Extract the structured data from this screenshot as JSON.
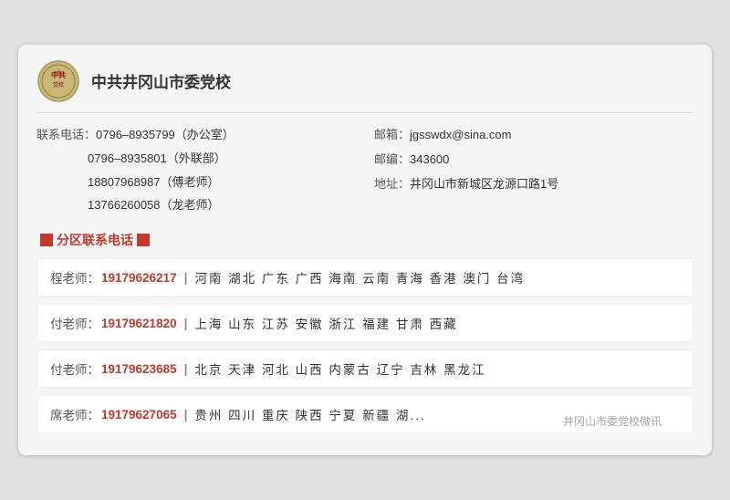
{
  "org": {
    "name": "中共井冈山市委党校",
    "logo_alt": "party-school-logo"
  },
  "contact": {
    "phones_label": "联系电话：",
    "phones": [
      {
        "number": "0796–8935799",
        "note": "（办公室）"
      },
      {
        "number": "0796–8935801",
        "note": "（外联部）"
      },
      {
        "number": "18807968987",
        "note": "（傅老师）"
      },
      {
        "number": "13766260058",
        "note": "（龙老师）"
      }
    ],
    "email_label": "邮箱：",
    "email": "jgsswdx@sina.com",
    "postcode_label": "邮编：",
    "postcode": "343600",
    "address_label": "地址：",
    "address": "井冈山市新城区龙源口路1号"
  },
  "section_title": "分区联系电话",
  "regions": [
    {
      "teacher": "程老师：",
      "phone": "19179626217",
      "areas": "河南  湖北  广东  广西  海南  云南  青海  香港  澳门  台湾"
    },
    {
      "teacher": "付老师：",
      "phone": "19179621820",
      "areas": "上海  山东  江苏  安徽  浙江  福建  甘肃  西藏"
    },
    {
      "teacher": "付老师：",
      "phone": "19179623685",
      "areas": "北京  天津  河北  山西  内蒙古  辽宁  吉林  黑龙江"
    },
    {
      "teacher": "席老师：",
      "phone": "19179627065",
      "areas": "贵州  四川  重庆  陕西  宁夏  新疆  湖..."
    }
  ],
  "watermark": "井冈山市委党校微讯"
}
